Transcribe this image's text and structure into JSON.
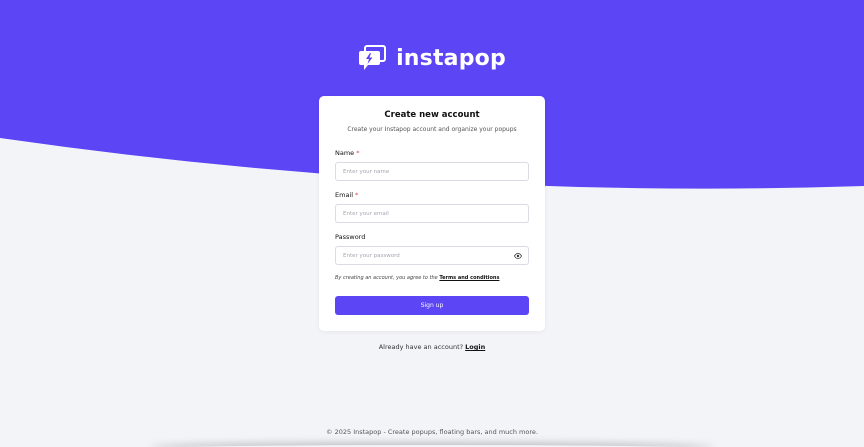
{
  "brand": {
    "name": "instapop",
    "logo_icon": "lightning-cards-icon",
    "primary_color": "#5b45f5"
  },
  "card": {
    "title": "Create new account",
    "subtitle": "Create your Instapop account and organize your popups",
    "fields": {
      "name": {
        "label": "Name",
        "required_mark": "*",
        "placeholder": "Enter your name"
      },
      "email": {
        "label": "Email",
        "required_mark": "*",
        "placeholder": "Enter your email"
      },
      "password": {
        "label": "Password",
        "placeholder": "Enter your password",
        "toggle_icon": "eye-icon"
      }
    },
    "terms_prefix": "By creating an account, you agree to the ",
    "terms_link": "Terms and conditions",
    "submit_label": "Sign up"
  },
  "login": {
    "prompt": "Already have an account? ",
    "link": "Login"
  },
  "footer": {
    "text": "© 2025 Instapop - Create popups, floating bars, and much more."
  }
}
